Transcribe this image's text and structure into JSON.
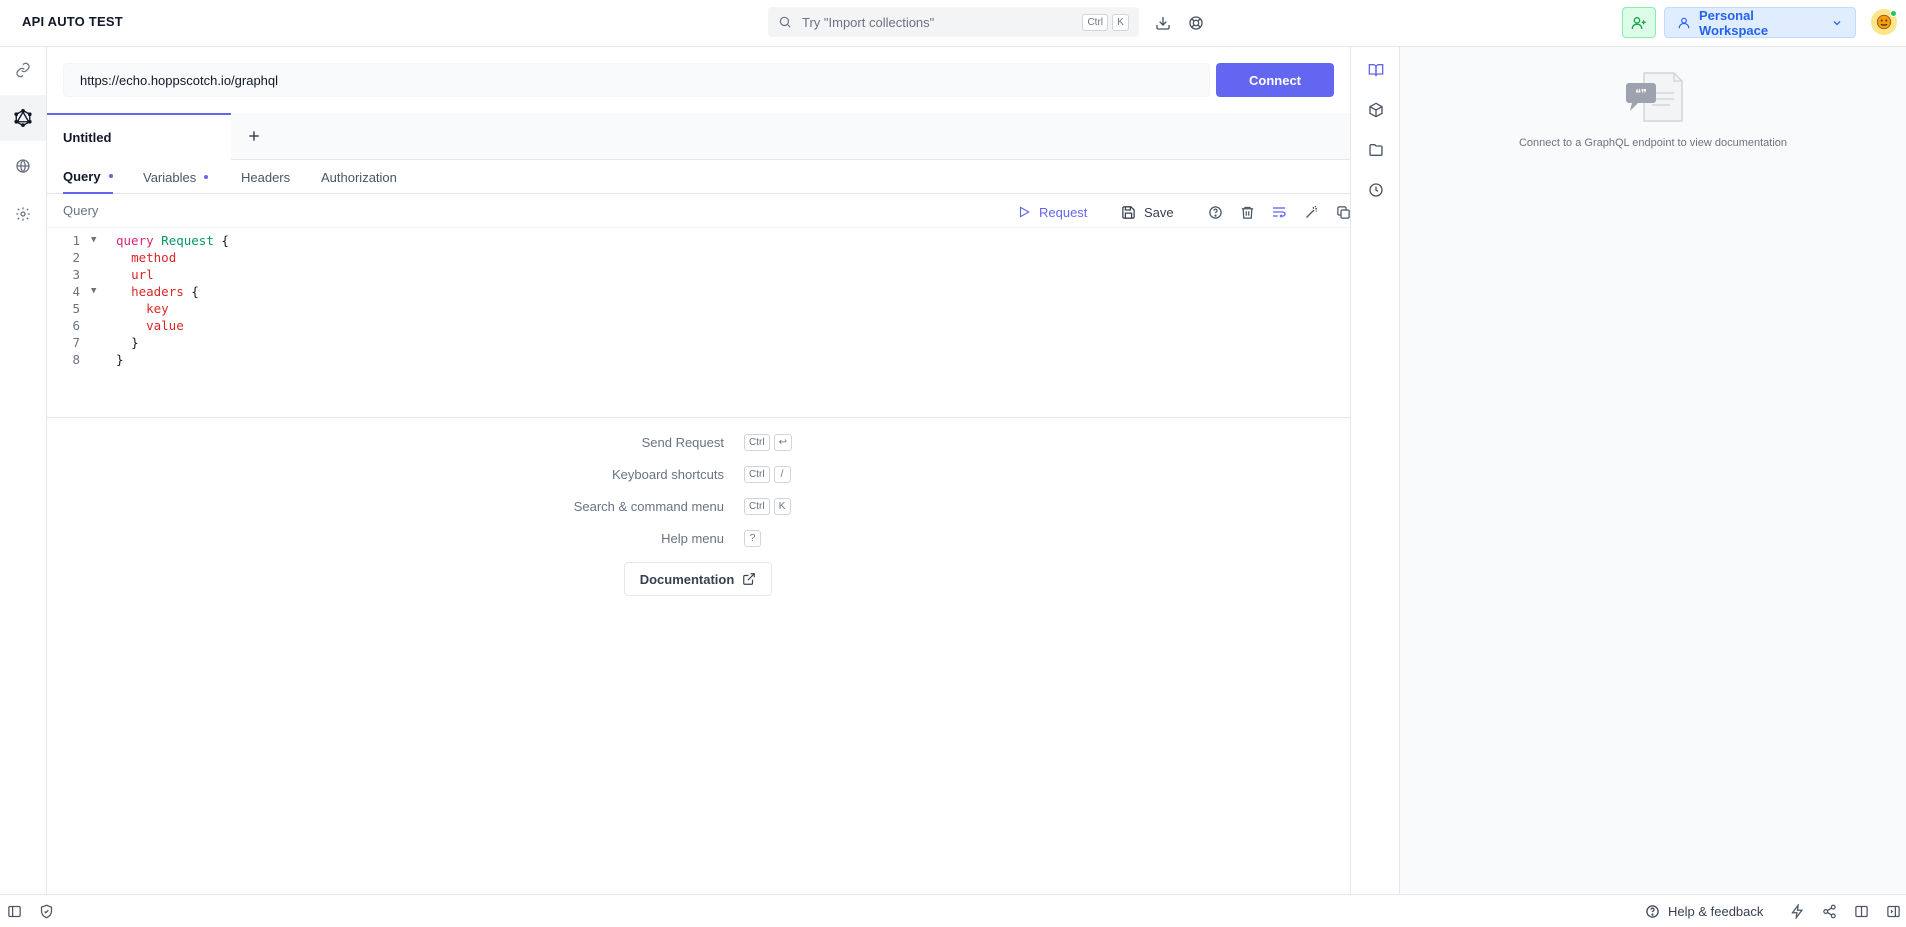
{
  "header": {
    "app_title": "API AUTO TEST",
    "search": {
      "placeholder": "Try \"Import collections\"",
      "shortcut_mod": "Ctrl",
      "shortcut_key": "K"
    },
    "workspace_label": "Personal Workspace"
  },
  "left_nav": {
    "items": [
      {
        "name": "rest",
        "icon": "link-icon"
      },
      {
        "name": "graphql",
        "icon": "graphql-icon",
        "active": true
      },
      {
        "name": "realtime",
        "icon": "globe-icon"
      },
      {
        "name": "settings",
        "icon": "gear-icon"
      }
    ]
  },
  "request": {
    "url": "https://echo.hoppscotch.io/graphql",
    "connect_label": "Connect"
  },
  "tabs": [
    {
      "label": "Untitled",
      "active": true
    }
  ],
  "subtabs": [
    {
      "label": "Query",
      "active": true,
      "indicator": true
    },
    {
      "label": "Variables",
      "active": false,
      "indicator": true
    },
    {
      "label": "Headers",
      "active": false,
      "indicator": false
    },
    {
      "label": "Authorization",
      "active": false,
      "indicator": false
    }
  ],
  "query_toolbar": {
    "label": "Query",
    "request_label": "Request",
    "save_label": "Save"
  },
  "editor": {
    "lines": [
      {
        "n": "1",
        "fold": true
      },
      {
        "n": "2",
        "fold": false
      },
      {
        "n": "3",
        "fold": false
      },
      {
        "n": "4",
        "fold": true
      },
      {
        "n": "5",
        "fold": false
      },
      {
        "n": "6",
        "fold": false
      },
      {
        "n": "7",
        "fold": false
      },
      {
        "n": "8",
        "fold": false
      }
    ],
    "tokens": {
      "query": "query",
      "op_name": "Request",
      "open": "{",
      "method": "method",
      "url": "url",
      "headers": "headers",
      "key": "key",
      "value": "value",
      "close": "}"
    }
  },
  "shortcuts": [
    {
      "label": "Send Request",
      "keys": [
        "Ctrl",
        "↩"
      ]
    },
    {
      "label": "Keyboard shortcuts",
      "keys": [
        "Ctrl",
        "/"
      ]
    },
    {
      "label": "Search & command menu",
      "keys": [
        "Ctrl",
        "K"
      ]
    },
    {
      "label": "Help menu",
      "keys": [
        "?"
      ]
    }
  ],
  "documentation_label": "Documentation",
  "docs_panel": {
    "message": "Connect to a GraphQL endpoint to view documentation"
  },
  "footer": {
    "help_label": "Help & feedback"
  },
  "colors": {
    "accent": "#6366f1",
    "invite_green": "#16a34a",
    "workspace_blue": "#2563eb"
  }
}
